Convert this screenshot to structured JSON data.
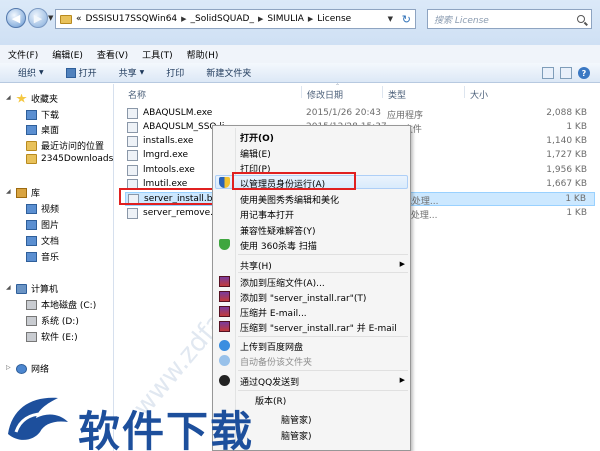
{
  "address": {
    "prefix": "«",
    "crumbs": [
      "DSSISU17SSQWin64",
      "_SolidSQUAD_",
      "SIMULIA",
      "License"
    ],
    "search_placeholder": "搜索 License"
  },
  "menubar": {
    "items": [
      "文件(F)",
      "编辑(E)",
      "查看(V)",
      "工具(T)",
      "帮助(H)"
    ]
  },
  "toolbar": {
    "organize": "组织",
    "open": "打开",
    "share": "共享",
    "print": "打印",
    "new_folder": "新建文件夹"
  },
  "nav": {
    "favorites": "收藏夹",
    "downloads": "下载",
    "desktop": "桌面",
    "recent": "最近访问的位置",
    "downloads2345": "2345Downloads",
    "libraries": "库",
    "videos": "视频",
    "pictures": "图片",
    "documents": "文档",
    "music": "音乐",
    "computer": "计算机",
    "drive_c": "本地磁盘 (C:)",
    "drive_d": "系统 (D:)",
    "drive_e": "软件 (E:)",
    "network": "网络"
  },
  "columns": {
    "name": "名称",
    "modified": "修改日期",
    "type": "类型",
    "size": "大小"
  },
  "files": [
    {
      "name": "ABAQUSLM.exe",
      "date": "2015/1/26 20:43",
      "type": "应用程序",
      "size": "2,088 KB"
    },
    {
      "name": "ABAQUSLM_SSQ.li...",
      "date": "2015/12/28 15:37",
      "type": "LIC 文件",
      "size": "1 KB"
    },
    {
      "name": "installs.exe",
      "date": "",
      "type": "",
      "size": "1,140 KB"
    },
    {
      "name": "lmgrd.exe",
      "date": "",
      "type": "",
      "size": "1,727 KB"
    },
    {
      "name": "lmtools.exe",
      "date": "",
      "type": "",
      "size": "1,956 KB"
    },
    {
      "name": "lmutil.exe",
      "date": "",
      "type": "",
      "size": "1,667 KB"
    },
    {
      "name": "server_install.bat",
      "date": "",
      "type": "ws 批处理...",
      "size": "1 KB"
    },
    {
      "name": "server_remove.bat",
      "date": "",
      "type": "ws 批处理...",
      "size": "1 KB"
    }
  ],
  "context_menu": {
    "open": "打开(O)",
    "edit": "编辑(E)",
    "print": "打印(P)",
    "run_as_admin": "以管理员身份运行(A)",
    "meitu": "使用美图秀秀编辑和美化",
    "notepad": "用记事本打开",
    "compat": "兼容性疑难解答(Y)",
    "scan360": "使用 360杀毒 扫描",
    "share": "共享(H)",
    "add_archive": "添加到压缩文件(A)...",
    "add_rar": "添加到 \"server_install.rar\"(T)",
    "compress_email": "压缩并 E-mail...",
    "compress_rar_email": "压缩到 \"server_install.rar\" 并 E-mail",
    "baidu": "上传到百度网盘",
    "auto_backup": "自动备份该文件夹",
    "qq_send": "通过QQ发送到",
    "version": "版本(R)",
    "housekeeper1": "脑管家)",
    "housekeeper2": "脑管家)"
  },
  "watermark": {
    "text": "软件下载",
    "site": "www.zdfans.com"
  },
  "colors": {
    "highlight_border": "#e02020",
    "selection": "#cce8ff",
    "watermark": "#1d4f9c"
  }
}
